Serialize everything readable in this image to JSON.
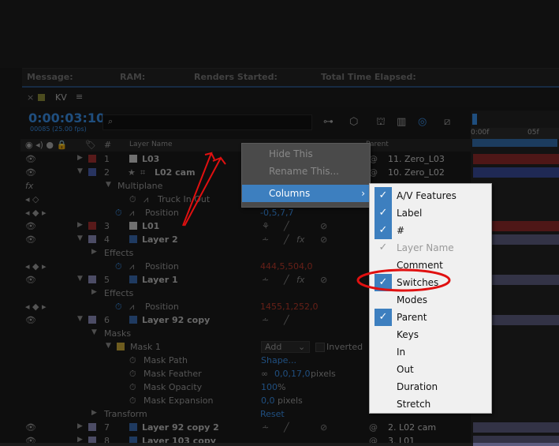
{
  "render_status": {
    "message": "Message:",
    "ram": "RAM:",
    "renders_started": "Renders Started:",
    "total_time": "Total Time Elapsed:"
  },
  "panel": {
    "close": "×",
    "comp_name": "KV",
    "menu_glyph": "≡"
  },
  "time": {
    "timecode": "0:00:03:10",
    "frames": "00085 (25.00 fps)"
  },
  "ruler": {
    "t0": "0:00f",
    "t1": "05f"
  },
  "columns": {
    "number": "#",
    "layer_name": "Layer Name",
    "parent": "Parent"
  },
  "layers": [
    {
      "num": "1",
      "name": "L03",
      "parent": "11. Zero_L03"
    },
    {
      "num": "2",
      "name": "L02 cam",
      "parent": "10. Zero_L02"
    },
    {
      "num": "3",
      "name": "L01"
    },
    {
      "num": "4",
      "name": "Layer 2"
    },
    {
      "num": "5",
      "name": "Layer 1"
    },
    {
      "num": "6",
      "name": "Layer 92 copy"
    },
    {
      "num": "7",
      "name": "Layer 92 copy 2",
      "parent": "2. L02 cam"
    },
    {
      "num": "8",
      "name": "Layer 103 copy",
      "parent": "3. L01"
    }
  ],
  "props": {
    "multiplane": "Multiplane",
    "truck": "Truck In Out",
    "position": "Position",
    "effects": "Effects",
    "masks": "Masks",
    "mask1": "Mask 1",
    "mask_mode": "Add",
    "inverted": "Inverted",
    "mask_path": "Mask Path",
    "shape": "Shape...",
    "mask_feather": "Mask Feather",
    "feather_val": "0,0,17,0",
    "pixels": "pixels",
    "mask_opacity": "Mask Opacity",
    "opacity_val": "100",
    "percent": "%",
    "mask_expansion": "Mask Expansion",
    "expansion_val": "0,0",
    "transform": "Transform",
    "reset": "Reset",
    "pos2": "-0,5,7,7",
    "pos4": "444,5,504,0",
    "pos5": "1455,1,252,0",
    "fx": "fx"
  },
  "context_menu": {
    "hide": "Hide This",
    "rename": "Rename This...",
    "columns": "Columns"
  },
  "columns_menu": [
    {
      "label": "A/V Features",
      "checked": true
    },
    {
      "label": "Label",
      "checked": true
    },
    {
      "label": "#",
      "checked": true
    },
    {
      "label": "Layer Name",
      "checked": true,
      "disabled": true
    },
    {
      "label": "Comment",
      "checked": false
    },
    {
      "label": "Switches",
      "checked": true
    },
    {
      "label": "Modes",
      "checked": false
    },
    {
      "label": "Parent",
      "checked": true
    },
    {
      "label": "Keys",
      "checked": false
    },
    {
      "label": "In",
      "checked": false
    },
    {
      "label": "Out",
      "checked": false
    },
    {
      "label": "Duration",
      "checked": false
    },
    {
      "label": "Stretch",
      "checked": false
    }
  ],
  "colors": {
    "accent": "#3a8ee6",
    "annotation": "#e01010",
    "label_red": "#a03030",
    "label_blue": "#4a5fb0",
    "label_lavender": "#8a8ab8"
  }
}
